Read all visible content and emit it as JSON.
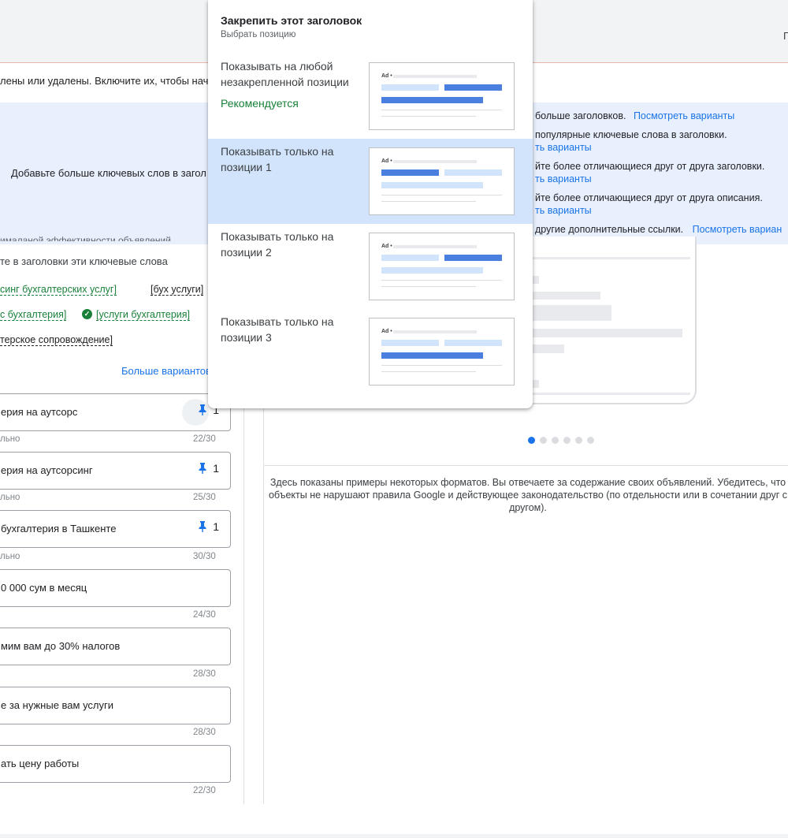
{
  "topbar": {
    "right_letter": "Г"
  },
  "notice": "лены или удалены. Включите их, чтобы начать",
  "banner": {
    "left_text": "Добавьте больше ключевых слов в загол",
    "lines": [
      {
        "text": "больше заголовков.",
        "link": "Посмотреть варианты"
      },
      {
        "text": "популярные ключевые слова в заголовки.",
        "link": ""
      },
      {
        "text": "",
        "link": "ть варианты"
      },
      {
        "text": "йте более отличающиеся друг от друга заголовки.",
        "link": ""
      },
      {
        "text": "",
        "link": "ть варианты"
      },
      {
        "text": "йте более отличающиеся друг от друга описания.",
        "link": ""
      },
      {
        "text": "",
        "link": "ть варианты"
      },
      {
        "text": "другие дополнительные ссылки.",
        "link": "Посмотреть вариан"
      }
    ]
  },
  "keywords": {
    "subhead": "ималаной эффективности объявлений",
    "intro": "те в заголовки эти ключевые слова",
    "items": [
      {
        "text": "синг бухгалтерских услуг]",
        "style": "green"
      },
      {
        "text": "[бух услуги]",
        "style": "dark"
      },
      {
        "text": "с бухгалтерия]",
        "style": "green"
      },
      {
        "text": "[услуги бухгалтерия]",
        "style": "green"
      },
      {
        "text": "терское сопровождение]",
        "style": "dark"
      }
    ],
    "more_link": "Больше вариантов"
  },
  "headlines": [
    {
      "text": "ерия на аутсорс",
      "pinned": "1",
      "note": "льно",
      "count": "22/30"
    },
    {
      "text": "ерия на аутсорсинг",
      "pinned": "1",
      "note": "льно",
      "count": "25/30"
    },
    {
      "text": " бухгалтерия в Ташкенте",
      "pinned": "1",
      "note": "льно",
      "count": "30/30"
    },
    {
      "text": "0 000 сум в месяц",
      "pinned": "",
      "note": "",
      "count": "24/30"
    },
    {
      "text": "мим вам до 30% налогов",
      "pinned": "",
      "note": "",
      "count": "28/30"
    },
    {
      "text": "е за нужные вам услуги",
      "pinned": "",
      "note": "",
      "count": "28/30"
    },
    {
      "text": "ать цену работы",
      "pinned": "",
      "note": "",
      "count": "22/30"
    }
  ],
  "preview": {
    "disclaimer": "Здесь показаны примеры некоторых форматов. Вы отвечаете за содержание своих объявлений. Убедитесь, что объекты не нарушают правила Google и действующее законодательство (по отдельности или в сочетании друг с другом).",
    "dots": 6,
    "active_dot": 0
  },
  "popup": {
    "title": "Закрепить этот заголовок",
    "subtitle": "Выбрать позицию",
    "options": [
      {
        "label": "Показывать на любой незакрепленной позиции",
        "recommended": "Рекомендуется",
        "selected": false
      },
      {
        "label": "Показывать только на позиции 1",
        "recommended": "",
        "selected": true
      },
      {
        "label": "Показывать только на позиции 2",
        "recommended": "",
        "selected": false
      },
      {
        "label": "Показывать только на позиции 3",
        "recommended": "",
        "selected": false
      }
    ],
    "ad_badge": "Ad •"
  },
  "colors": {
    "accent": "#1a73e8",
    "green": "#188038",
    "banner_bg": "#e8f0fe",
    "selected_bg": "#d2e3fc"
  }
}
